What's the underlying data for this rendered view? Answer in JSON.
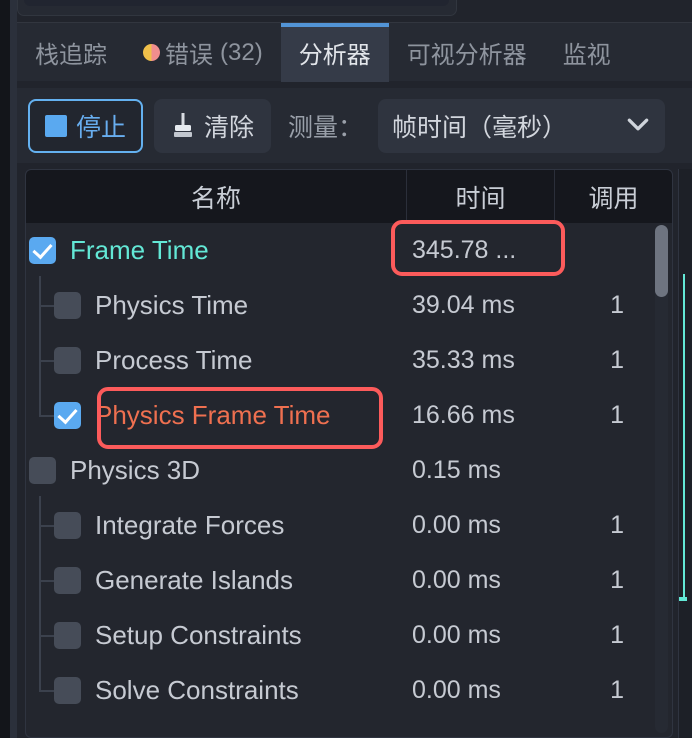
{
  "window": {
    "accent_blue": "#5294d6",
    "accent_teal": "#63e8d6",
    "annotation_red": "#fc5b5b",
    "panel_bg": "#262a33"
  },
  "tabs": [
    {
      "label": "栈追踪",
      "icon": "",
      "active": false
    },
    {
      "label": "错误",
      "count": "(32)",
      "icon": "error-dot-icon",
      "active": false
    },
    {
      "label": "分析器",
      "icon": "",
      "active": true
    },
    {
      "label": "可视分析器",
      "icon": "",
      "active": false
    },
    {
      "label": "监视",
      "icon": "",
      "active": false
    }
  ],
  "toolbar": {
    "stop_label": "停止",
    "stop_icon": "stop-square-icon",
    "clear_label": "清除",
    "clear_icon": "broom-icon",
    "measure_label": "测量：",
    "measure_value": "帧时间（毫秒）",
    "measure_chevron": "⌄"
  },
  "table": {
    "columns": {
      "name": "名称",
      "time": "时间",
      "calls": "调用"
    },
    "rows": [
      {
        "name": "Frame Time",
        "time": "345.78 ...",
        "calls": "",
        "checked": true,
        "depth": 0,
        "color": "teal",
        "annotated_time": true
      },
      {
        "name": "Physics Time",
        "time": "39.04 ms",
        "calls": "1",
        "checked": false,
        "depth": 1,
        "color": "normal"
      },
      {
        "name": "Process Time",
        "time": "35.33 ms",
        "calls": "1",
        "checked": false,
        "depth": 1,
        "color": "normal"
      },
      {
        "name": "Physics Frame Time",
        "time": "16.66 ms",
        "calls": "1",
        "checked": true,
        "depth": 1,
        "color": "orange",
        "annotated_name": true
      },
      {
        "name": "Physics 3D",
        "time": "0.15 ms",
        "calls": "",
        "checked": false,
        "depth": 0,
        "color": "normal"
      },
      {
        "name": "Integrate Forces",
        "time": "0.00 ms",
        "calls": "1",
        "checked": false,
        "depth": 1,
        "color": "normal"
      },
      {
        "name": "Generate Islands",
        "time": "0.00 ms",
        "calls": "1",
        "checked": false,
        "depth": 1,
        "color": "normal"
      },
      {
        "name": "Setup Constraints",
        "time": "0.00 ms",
        "calls": "1",
        "checked": false,
        "depth": 1,
        "color": "normal"
      },
      {
        "name": "Solve Constraints",
        "time": "0.00 ms",
        "calls": "1",
        "checked": false,
        "depth": 1,
        "color": "normal"
      }
    ]
  }
}
